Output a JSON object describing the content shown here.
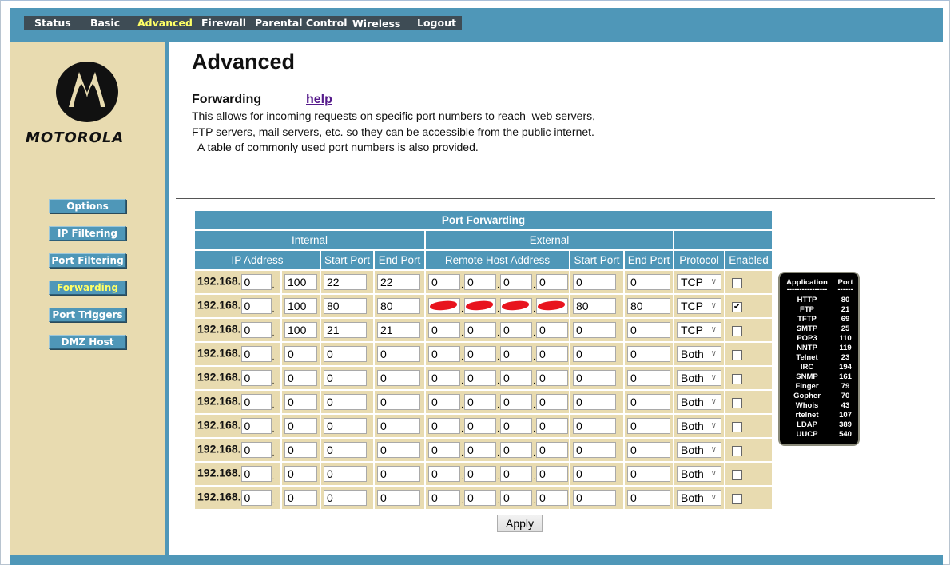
{
  "nav": {
    "items": [
      {
        "label": "Status",
        "active": false
      },
      {
        "label": "Basic",
        "active": false
      },
      {
        "label": "Advanced",
        "active": true
      },
      {
        "label": "Firewall",
        "active": false
      },
      {
        "label": "Parental Control",
        "active": false
      },
      {
        "label": "Wireless",
        "active": false
      },
      {
        "label": "Logout",
        "active": false
      }
    ]
  },
  "brand": {
    "name": "MOTOROLA"
  },
  "sidebar": {
    "items": [
      {
        "label": "Options",
        "active": false
      },
      {
        "label": "IP Filtering",
        "active": false
      },
      {
        "label": "Port Filtering",
        "active": false
      },
      {
        "label": "Forwarding",
        "active": true
      },
      {
        "label": "Port Triggers",
        "active": false
      },
      {
        "label": "DMZ Host",
        "active": false
      }
    ]
  },
  "page": {
    "title": "Advanced",
    "section": "Forwarding",
    "help": "help",
    "description": "This allows for incoming requests on specific port numbers to reach  web servers,\nFTP servers, mail servers, etc. so they can be accessible from the public internet.\n  A table of commonly used port numbers is also provided."
  },
  "table": {
    "title": "Port Forwarding",
    "groups": {
      "internal": "Internal",
      "external": "External"
    },
    "headers": {
      "ip": "IP Address",
      "start": "Start Port",
      "end": "End Port",
      "remote": "Remote Host Address",
      "ext_start": "Start Port",
      "ext_end": "End Port",
      "protocol": "Protocol",
      "enabled": "Enabled"
    },
    "ip_prefix": "192.168.",
    "rows": [
      {
        "ip3": "0",
        "ip4": "100",
        "start": "22",
        "end": "22",
        "remote": [
          "0",
          "0",
          "0",
          "0"
        ],
        "redacted": false,
        "ext_start": "0",
        "ext_end": "0",
        "protocol": "TCP",
        "enabled": false
      },
      {
        "ip3": "0",
        "ip4": "100",
        "start": "80",
        "end": "80",
        "remote": [
          "",
          "",
          "",
          ""
        ],
        "redacted": true,
        "ext_start": "80",
        "ext_end": "80",
        "protocol": "TCP",
        "enabled": true
      },
      {
        "ip3": "0",
        "ip4": "100",
        "start": "21",
        "end": "21",
        "remote": [
          "0",
          "0",
          "0",
          "0"
        ],
        "redacted": false,
        "ext_start": "0",
        "ext_end": "0",
        "protocol": "TCP",
        "enabled": false
      },
      {
        "ip3": "0",
        "ip4": "0",
        "start": "0",
        "end": "0",
        "remote": [
          "0",
          "0",
          "0",
          "0"
        ],
        "redacted": false,
        "ext_start": "0",
        "ext_end": "0",
        "protocol": "Both",
        "enabled": false
      },
      {
        "ip3": "0",
        "ip4": "0",
        "start": "0",
        "end": "0",
        "remote": [
          "0",
          "0",
          "0",
          "0"
        ],
        "redacted": false,
        "ext_start": "0",
        "ext_end": "0",
        "protocol": "Both",
        "enabled": false
      },
      {
        "ip3": "0",
        "ip4": "0",
        "start": "0",
        "end": "0",
        "remote": [
          "0",
          "0",
          "0",
          "0"
        ],
        "redacted": false,
        "ext_start": "0",
        "ext_end": "0",
        "protocol": "Both",
        "enabled": false
      },
      {
        "ip3": "0",
        "ip4": "0",
        "start": "0",
        "end": "0",
        "remote": [
          "0",
          "0",
          "0",
          "0"
        ],
        "redacted": false,
        "ext_start": "0",
        "ext_end": "0",
        "protocol": "Both",
        "enabled": false
      },
      {
        "ip3": "0",
        "ip4": "0",
        "start": "0",
        "end": "0",
        "remote": [
          "0",
          "0",
          "0",
          "0"
        ],
        "redacted": false,
        "ext_start": "0",
        "ext_end": "0",
        "protocol": "Both",
        "enabled": false
      },
      {
        "ip3": "0",
        "ip4": "0",
        "start": "0",
        "end": "0",
        "remote": [
          "0",
          "0",
          "0",
          "0"
        ],
        "redacted": false,
        "ext_start": "0",
        "ext_end": "0",
        "protocol": "Both",
        "enabled": false
      },
      {
        "ip3": "0",
        "ip4": "0",
        "start": "0",
        "end": "0",
        "remote": [
          "0",
          "0",
          "0",
          "0"
        ],
        "redacted": false,
        "ext_start": "0",
        "ext_end": "0",
        "protocol": "Both",
        "enabled": false
      }
    ],
    "apply": "Apply"
  },
  "apps": {
    "headers": {
      "app": "Application",
      "port": "Port",
      "app_sep": "----------------",
      "port_sep": "------"
    },
    "rows": [
      {
        "app": "HTTP",
        "port": "80"
      },
      {
        "app": "FTP",
        "port": "21"
      },
      {
        "app": "TFTP",
        "port": "69"
      },
      {
        "app": "SMTP",
        "port": "25"
      },
      {
        "app": "POP3",
        "port": "110"
      },
      {
        "app": "NNTP",
        "port": "119"
      },
      {
        "app": "Telnet",
        "port": "23"
      },
      {
        "app": "IRC",
        "port": "194"
      },
      {
        "app": "SNMP",
        "port": "161"
      },
      {
        "app": "Finger",
        "port": "79"
      },
      {
        "app": "Gopher",
        "port": "70"
      },
      {
        "app": "Whois",
        "port": "43"
      },
      {
        "app": "rtelnet",
        "port": "107"
      },
      {
        "app": "LDAP",
        "port": "389"
      },
      {
        "app": "UUCP",
        "port": "540"
      }
    ]
  },
  "colors": {
    "accent": "#4f97b8",
    "sidebar": "#e8dbb0",
    "nav": "#3e4c55",
    "active": "#ffff66",
    "redaction": "#e8141e"
  }
}
